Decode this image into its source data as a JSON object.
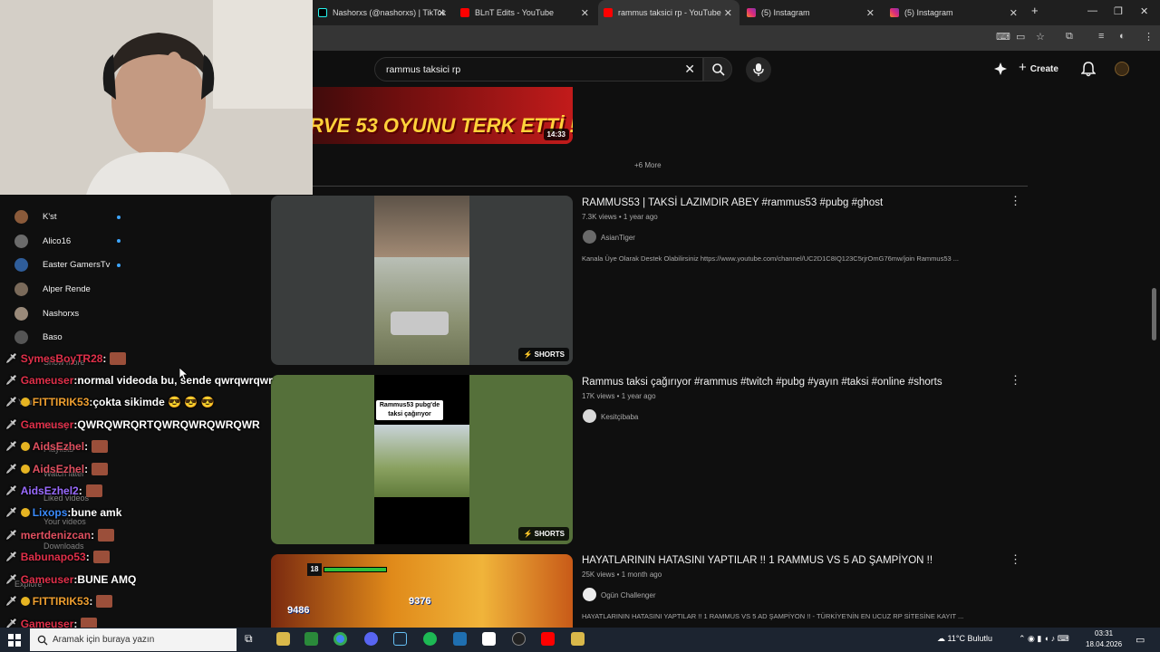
{
  "browser": {
    "tabs": [
      {
        "label": "Nashorxs (@nashorxs) | TikTok",
        "icon": "tiktok-icon"
      },
      {
        "label": "BLnT Edits - YouTube",
        "icon": "youtube-icon"
      },
      {
        "label": "rammus taksici rp - YouTube",
        "icon": "youtube-icon",
        "active": true
      },
      {
        "label": "(5) Instagram",
        "icon": "instagram-icon"
      },
      {
        "label": "(5) Instagram",
        "icon": "instagram-icon"
      }
    ]
  },
  "header": {
    "search_value": "rammus taksici rp",
    "create_label": "Create"
  },
  "results": {
    "top_duration": "14:33",
    "top_thumb_text": "RVE 53 OYUNU TERK ETTİ !",
    "more_label": "+6 More",
    "videos": [
      {
        "title": "RAMMUS53 | TAKSİ LAZIMDIR ABEY #rammus53 #pubg #ghost",
        "meta": "7.3K views • 1 year ago",
        "channel": "AsianTiger",
        "desc": "Kanala Üye Olarak Destek Olabilirsiniz https://www.youtube.com/channel/UC2D1C8IQ123C5rjrOmG76mw/join Rammus53 ...",
        "badge": "SHORTS"
      },
      {
        "title": "Rammus taksi çağırıyor #rammus #twitch #pubg #yayın #taksi #online #shorts",
        "meta": "17K views • 1 year ago",
        "channel": "Kesitçibaba",
        "desc": "",
        "badge": "SHORTS",
        "thumb_caption": "Rammus53 pubg'de taksi çağırıyor"
      },
      {
        "title": "HAYATLARININ HATASINI YAPTILAR !! 1 RAMMUS VS 5 AD ŞAMPİYON !!",
        "meta": "25K views • 1 month ago",
        "channel": "Ogün Challenger",
        "desc": "HAYATLARININ HATASINI YAPTILAR !! 1 RAMMUS VS 5 AD ŞAMPİYON !! - TÜRKİYE'NİN EN UCUZ RP SİTESİNE KAYIT ...",
        "thumb_numbers": [
          "18",
          "9376",
          "9486"
        ]
      }
    ]
  },
  "sidebar": {
    "subscriptions": [
      {
        "name": "K'st",
        "live": true
      },
      {
        "name": "Alico16",
        "live": true
      },
      {
        "name": "Easter GamersTv",
        "live": true
      },
      {
        "name": "Alper Rende",
        "live": false
      },
      {
        "name": "Nashorxs",
        "live": false
      },
      {
        "name": "Baso",
        "live": false
      }
    ],
    "faint_items": [
      "Show more",
      "You",
      "History",
      "Playlists",
      "Watch later",
      "Liked videos",
      "Your videos",
      "Downloads",
      "Explore"
    ]
  },
  "chat": [
    {
      "user": "SymesBoyTR28",
      "color": "#e0304a",
      "msg": "",
      "emote": true,
      "badge": false
    },
    {
      "user": "Gameuser",
      "color": "#e0304a",
      "msg": "normal videoda bu, sende qwrqwrqwr",
      "emote": false,
      "badge": false
    },
    {
      "user": "FITTIRIK53",
      "color": "#f0a030",
      "msg": "çokta sikimde 😎 😎 😎",
      "emote": false,
      "badge": true
    },
    {
      "user": "Gameuser",
      "color": "#e0304a",
      "msg": "QWRQWRQRTQWRQWRQWRQWR",
      "emote": false,
      "badge": false
    },
    {
      "user": "AidsEzhel",
      "color": "#e05060",
      "msg": "",
      "emote": true,
      "badge": true
    },
    {
      "user": "AidsEzhel",
      "color": "#e05060",
      "msg": "",
      "emote": true,
      "badge": true
    },
    {
      "user": "AidsEzhel2",
      "color": "#9a6bff",
      "msg": "",
      "emote": true,
      "badge": false
    },
    {
      "user": "Lixops",
      "color": "#3a8cff",
      "msg": "bune amk",
      "emote": false,
      "badge": true
    },
    {
      "user": "mertdenizcan",
      "color": "#e05060",
      "msg": "",
      "emote": true,
      "badge": false
    },
    {
      "user": "Babunapo53",
      "color": "#e0304a",
      "msg": "",
      "emote": true,
      "badge": false
    },
    {
      "user": "Gameuser",
      "color": "#e0304a",
      "msg": "BUNE AMQ",
      "emote": false,
      "badge": false
    },
    {
      "user": "FITTIRIK53",
      "color": "#f0a030",
      "msg": "",
      "emote": true,
      "badge": true
    },
    {
      "user": "Gameuser",
      "color": "#e0304a",
      "msg": "",
      "emote": true,
      "badge": false
    }
  ],
  "taskbar": {
    "search_placeholder": "Aramak için buraya yazın",
    "weather": "11°C Bulutlu",
    "time": "03:31",
    "date": "18.04.2026"
  },
  "colors": {
    "background": "#0f0f0f",
    "accent_live": "#3ea6ff",
    "youtube_red": "#ff0000"
  }
}
